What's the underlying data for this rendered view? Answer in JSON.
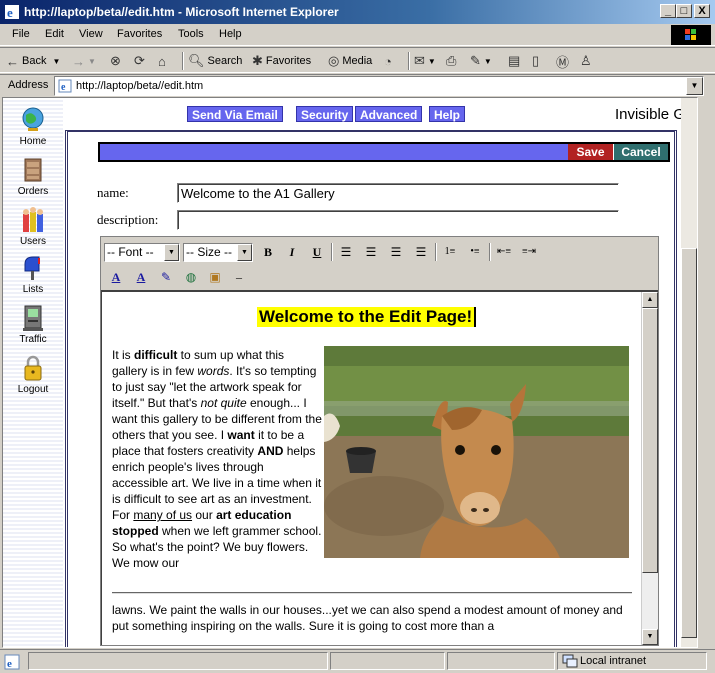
{
  "window": {
    "title": "http://laptop/beta//edit.htm - Microsoft Internet Explorer",
    "controls": [
      "_",
      "□",
      "X"
    ]
  },
  "menu": [
    "File",
    "Edit",
    "View",
    "Favorites",
    "Tools",
    "Help"
  ],
  "toolbar": {
    "back": "Back",
    "search": "Search",
    "favorites": "Favorites",
    "media": "Media"
  },
  "address": {
    "label": "Address",
    "url": "http://laptop/beta//edit.htm"
  },
  "sidenav": [
    "Home",
    "Orders",
    "Users",
    "Lists",
    "Traffic",
    "Logout"
  ],
  "topnav": [
    "Send Via Email",
    "Security",
    "Advanced",
    "Help"
  ],
  "brand": "Invisible Gold",
  "actions": {
    "save": "Save",
    "cancel": "Cancel"
  },
  "form": {
    "name_label": "name:",
    "name_value": "Welcome to the A1 Gallery",
    "description_label": "description:",
    "description_value": ""
  },
  "editor": {
    "font_select": "-- Font --",
    "size_select": "-- Size --",
    "heading": "Welcome to the Edit Page!",
    "body_parts": [
      "It is ",
      "difficult",
      " to sum up what this gallery is in few ",
      "words",
      ". It's so tempting to just say \"let the artwork speak for itself.\" But that's ",
      "not quite",
      " enough... I want this gallery to be different from the others that you see. I ",
      "want",
      " it to be a place that fosters creativity ",
      "AND",
      " helps enrich people's lives through accessible art. We live in a time when it is difficult to see art as an investment. For ",
      "many of us",
      " our ",
      "art education stopped",
      " when we left grammer school. So what's the point? We buy flowers. We mow our"
    ],
    "tail_text": "lawns. We paint the walls in our houses...yet we can also spend a modest amount of money and put something inspiring on the walls. Sure it is going to cost more than a"
  },
  "status": {
    "zone": "Local intranet"
  },
  "colors": {
    "nav_button": "#6666ee",
    "save": "#b22222",
    "cancel": "#2f6f6f",
    "highlight": "#ffff00"
  }
}
